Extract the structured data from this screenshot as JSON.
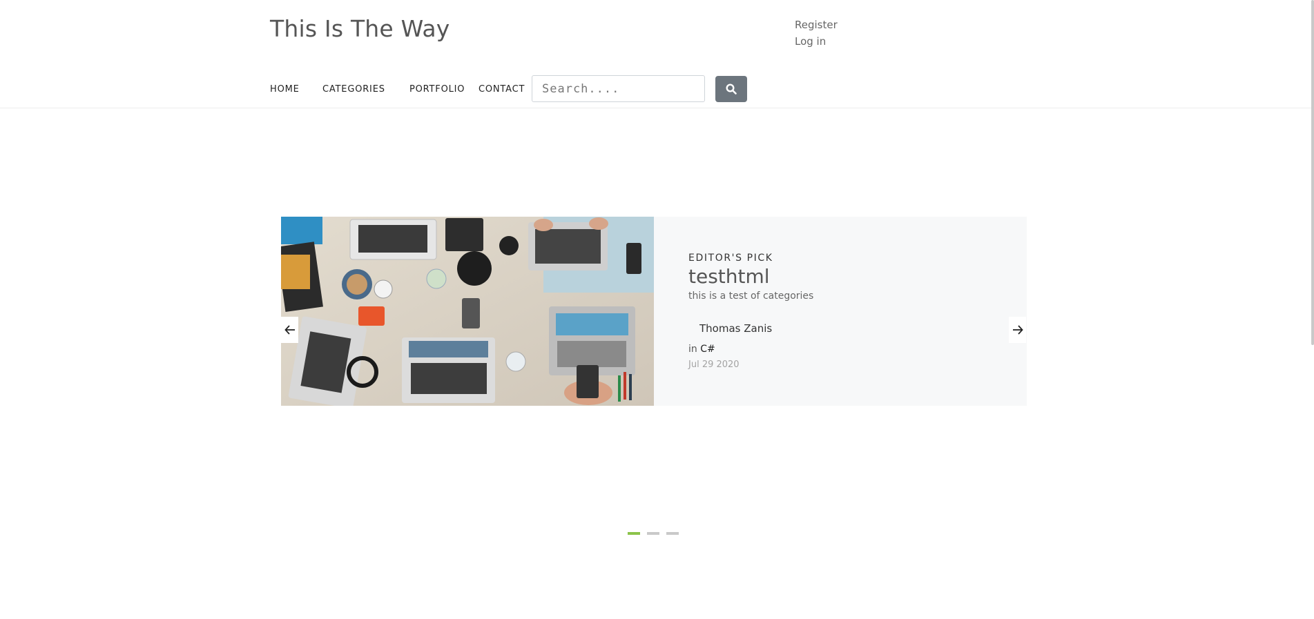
{
  "header": {
    "site_title": "This Is The Way",
    "account": {
      "register": "Register",
      "login": "Log in"
    }
  },
  "nav": {
    "items": [
      "HOME",
      "CATEGORIES",
      "PORTFOLIO",
      "CONTACT"
    ]
  },
  "search": {
    "placeholder": "Search....",
    "button_icon": "search-icon"
  },
  "slide": {
    "eyebrow": "EDITOR'S PICK",
    "title": "testhtml",
    "subtitle": "this is a test of categories",
    "author": "Thomas Zanis",
    "category_prefix": "in",
    "category": "C#",
    "date": "Jul 29 2020"
  },
  "carousel": {
    "slide_count": 3,
    "active_index": 0
  },
  "colors": {
    "accent_green": "#8bc34a",
    "search_button": "#6c757d",
    "slide_panel_bg": "#f7f8f9"
  }
}
